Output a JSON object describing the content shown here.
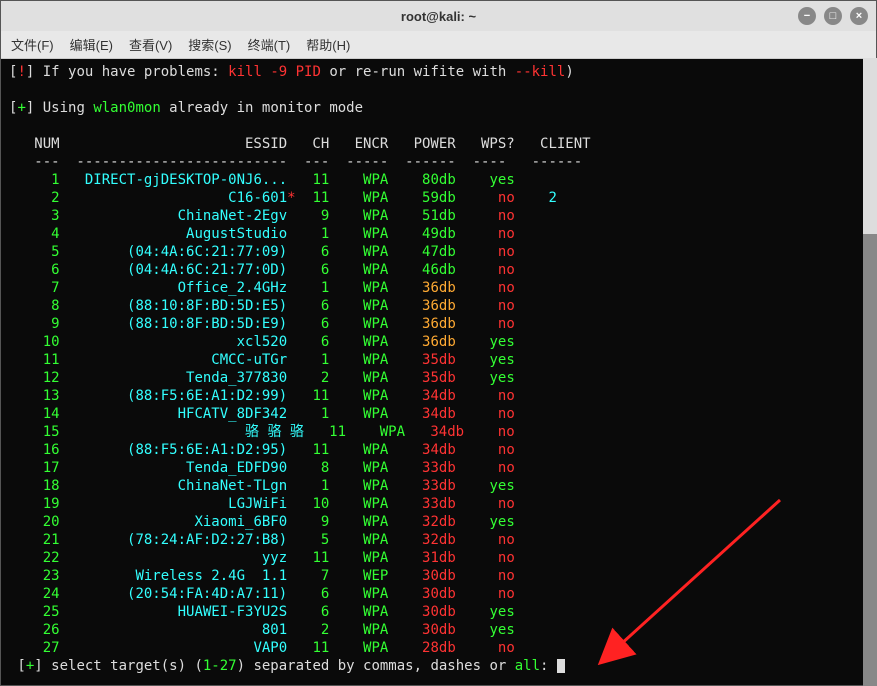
{
  "window": {
    "title": "root@kali: ~"
  },
  "menu": {
    "file": "文件(F)",
    "edit": "编辑(E)",
    "view": "查看(V)",
    "search": "搜索(S)",
    "terminal": "终端(T)",
    "help": "帮助(H)"
  },
  "line1": {
    "b1": "[",
    "bang": "!",
    "b2": "] ",
    "t1": "If you have problems: ",
    "cmd": "kill -9 PID",
    "t2": " or re-run wifite with ",
    "flag": "--kill",
    "b3": ")"
  },
  "line2": {
    "b1": "[",
    "plus": "+",
    "b2": "] ",
    "t1": "Using ",
    "iface": "wlan0mon",
    "t2": " already in monitor mode"
  },
  "header": "   NUM                      ESSID   CH   ENCR   POWER   WPS?   CLIENT",
  "divider": "   ---  -------------------------  ---  -----  ------  ----   ------",
  "rows": [
    {
      "num": "1",
      "essid": "DIRECT-gjDESKTOP-0NJ6...",
      "star": "",
      "ch": "11",
      "encr": "WPA",
      "power": "80db",
      "pcol": "g",
      "wps": "yes",
      "wcol": "g",
      "client": ""
    },
    {
      "num": "2",
      "essid": "C16-601",
      "star": "*",
      "ch": "11",
      "encr": "WPA",
      "power": "59db",
      "pcol": "g",
      "wps": "no",
      "wcol": "r",
      "client": "2"
    },
    {
      "num": "3",
      "essid": "ChinaNet-2Egv",
      "star": "",
      "ch": "9",
      "encr": "WPA",
      "power": "51db",
      "pcol": "g",
      "wps": "no",
      "wcol": "r",
      "client": ""
    },
    {
      "num": "4",
      "essid": "AugustStudio",
      "star": "",
      "ch": "1",
      "encr": "WPA",
      "power": "49db",
      "pcol": "g",
      "wps": "no",
      "wcol": "r",
      "client": ""
    },
    {
      "num": "5",
      "essid": "(04:4A:6C:21:77:09)",
      "star": "",
      "ch": "6",
      "encr": "WPA",
      "power": "47db",
      "pcol": "g",
      "wps": "no",
      "wcol": "r",
      "client": ""
    },
    {
      "num": "6",
      "essid": "(04:4A:6C:21:77:0D)",
      "star": "",
      "ch": "6",
      "encr": "WPA",
      "power": "46db",
      "pcol": "g",
      "wps": "no",
      "wcol": "r",
      "client": ""
    },
    {
      "num": "7",
      "essid": "Office_2.4GHz",
      "star": "",
      "ch": "1",
      "encr": "WPA",
      "power": "36db",
      "pcol": "o",
      "wps": "no",
      "wcol": "r",
      "client": ""
    },
    {
      "num": "8",
      "essid": "(88:10:8F:BD:5D:E5)",
      "star": "",
      "ch": "6",
      "encr": "WPA",
      "power": "36db",
      "pcol": "o",
      "wps": "no",
      "wcol": "r",
      "client": ""
    },
    {
      "num": "9",
      "essid": "(88:10:8F:BD:5D:E9)",
      "star": "",
      "ch": "6",
      "encr": "WPA",
      "power": "36db",
      "pcol": "o",
      "wps": "no",
      "wcol": "r",
      "client": ""
    },
    {
      "num": "10",
      "essid": "xcl520",
      "star": "",
      "ch": "6",
      "encr": "WPA",
      "power": "36db",
      "pcol": "o",
      "wps": "yes",
      "wcol": "g",
      "client": ""
    },
    {
      "num": "11",
      "essid": "CMCC-uTGr",
      "star": "",
      "ch": "1",
      "encr": "WPA",
      "power": "35db",
      "pcol": "r",
      "wps": "yes",
      "wcol": "g",
      "client": ""
    },
    {
      "num": "12",
      "essid": "Tenda_377830",
      "star": "",
      "ch": "2",
      "encr": "WPA",
      "power": "35db",
      "pcol": "r",
      "wps": "yes",
      "wcol": "g",
      "client": ""
    },
    {
      "num": "13",
      "essid": "(88:F5:6E:A1:D2:99)",
      "star": "",
      "ch": "11",
      "encr": "WPA",
      "power": "34db",
      "pcol": "r",
      "wps": "no",
      "wcol": "r",
      "client": ""
    },
    {
      "num": "14",
      "essid": "HFCATV_8DF342",
      "star": "",
      "ch": "1",
      "encr": "WPA",
      "power": "34db",
      "pcol": "r",
      "wps": "no",
      "wcol": "r",
      "client": ""
    },
    {
      "num": "15",
      "essid": "骆 骆 骆",
      "star": "",
      "ch": "11",
      "encr": "WPA",
      "power": "34db",
      "pcol": "r",
      "wps": "no",
      "wcol": "r",
      "client": "",
      "special": true
    },
    {
      "num": "16",
      "essid": "(88:F5:6E:A1:D2:95)",
      "star": "",
      "ch": "11",
      "encr": "WPA",
      "power": "34db",
      "pcol": "r",
      "wps": "no",
      "wcol": "r",
      "client": ""
    },
    {
      "num": "17",
      "essid": "Tenda_EDFD90",
      "star": "",
      "ch": "8",
      "encr": "WPA",
      "power": "33db",
      "pcol": "r",
      "wps": "no",
      "wcol": "r",
      "client": ""
    },
    {
      "num": "18",
      "essid": "ChinaNet-TLgn",
      "star": "",
      "ch": "1",
      "encr": "WPA",
      "power": "33db",
      "pcol": "r",
      "wps": "yes",
      "wcol": "g",
      "client": ""
    },
    {
      "num": "19",
      "essid": "LGJWiFi",
      "star": "",
      "ch": "10",
      "encr": "WPA",
      "power": "33db",
      "pcol": "r",
      "wps": "no",
      "wcol": "r",
      "client": ""
    },
    {
      "num": "20",
      "essid": "Xiaomi_6BF0",
      "star": "",
      "ch": "9",
      "encr": "WPA",
      "power": "32db",
      "pcol": "r",
      "wps": "yes",
      "wcol": "g",
      "client": ""
    },
    {
      "num": "21",
      "essid": "(78:24:AF:D2:27:B8)",
      "star": "",
      "ch": "5",
      "encr": "WPA",
      "power": "32db",
      "pcol": "r",
      "wps": "no",
      "wcol": "r",
      "client": ""
    },
    {
      "num": "22",
      "essid": "yyz",
      "star": "",
      "ch": "11",
      "encr": "WPA",
      "power": "31db",
      "pcol": "r",
      "wps": "no",
      "wcol": "r",
      "client": ""
    },
    {
      "num": "23",
      "essid": "Wireless 2.4G  1.1",
      "star": "",
      "ch": "7",
      "encr": "WEP",
      "power": "30db",
      "pcol": "r",
      "wps": "no",
      "wcol": "r",
      "client": ""
    },
    {
      "num": "24",
      "essid": "(20:54:FA:4D:A7:11)",
      "star": "",
      "ch": "6",
      "encr": "WPA",
      "power": "30db",
      "pcol": "r",
      "wps": "no",
      "wcol": "r",
      "client": ""
    },
    {
      "num": "25",
      "essid": "HUAWEI-F3YU2S",
      "star": "",
      "ch": "6",
      "encr": "WPA",
      "power": "30db",
      "pcol": "r",
      "wps": "yes",
      "wcol": "g",
      "client": ""
    },
    {
      "num": "26",
      "essid": "801",
      "star": "",
      "ch": "2",
      "encr": "WPA",
      "power": "30db",
      "pcol": "r",
      "wps": "yes",
      "wcol": "g",
      "client": ""
    },
    {
      "num": "27",
      "essid": "VAP0",
      "star": "",
      "ch": "11",
      "encr": "WPA",
      "power": "28db",
      "pcol": "r",
      "wps": "no",
      "wcol": "r",
      "client": ""
    }
  ],
  "prompt": {
    "b1": " [",
    "plus": "+",
    "b2": "] ",
    "t1": "select target(s) (",
    "range": "1-27",
    "t2": ") separated by commas, dashes or ",
    "all": "all",
    "t3": ": "
  }
}
